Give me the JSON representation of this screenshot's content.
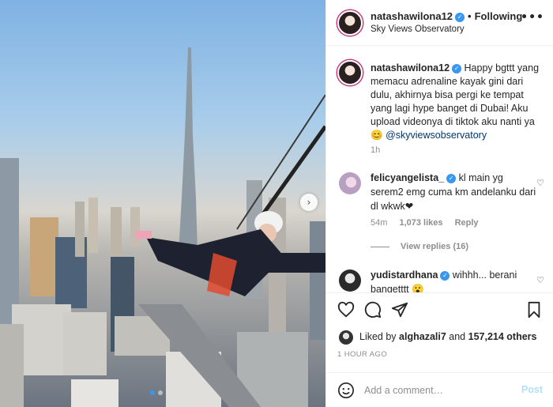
{
  "post": {
    "username": "natashawilona12",
    "follow_status": "Following",
    "location": "Sky Views Observatory",
    "more_label": "•••"
  },
  "caption": {
    "username": "natashawilona12",
    "text": "Happy bgttt yang memacu adrenaline kayak gini dari dulu, akhirnya bisa pergi ke tempat yang lagi hype banget di Dubai! Aku upload videonya di tiktok aku nanti ya 😊",
    "mention": "@skyviewsobservatory",
    "time": "1h"
  },
  "comments": [
    {
      "username": "felicyangelista_",
      "text": "kl main yg serem2 emg cuma km andelanku dari dl wkwk❤",
      "time": "54m",
      "likes": "1,073 likes",
      "reply_label": "Reply",
      "view_replies": "View replies (16)"
    },
    {
      "username": "yudistardhana",
      "text": "wihhh... berani bangetttt 😮"
    }
  ],
  "likes": {
    "prefix": "Liked by",
    "user": "alghazali7",
    "connector": "and",
    "others": "157,214 others"
  },
  "timestamp": "1 HOUR AGO",
  "add_comment": {
    "placeholder": "Add a comment…",
    "post_label": "Post"
  },
  "carousel": {
    "next_icon": "chevron-right-icon",
    "dot_count": 2,
    "active_index": 0
  },
  "colors": {
    "verified": "#3897f0",
    "mention": "#00376b",
    "post_disabled": "#b2dffc",
    "meta": "#8e8e8e"
  }
}
